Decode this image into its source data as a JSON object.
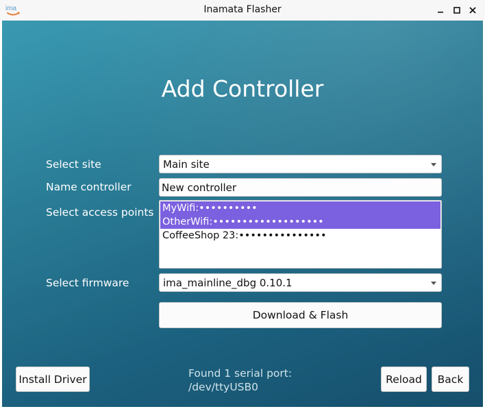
{
  "window": {
    "title": "Inamata Flasher",
    "icon": "ima-logo-icon",
    "icon_text": "ima",
    "controls": {
      "minimize": "minimize-icon",
      "maximize": "maximize-icon",
      "close": "close-icon"
    }
  },
  "page": {
    "heading": "Add Controller"
  },
  "form": {
    "site": {
      "label": "Select site",
      "value": "Main site"
    },
    "name": {
      "label": "Name controller",
      "value": "New controller"
    },
    "access_points": {
      "label": "Select access points",
      "items": [
        {
          "text": "MyWifi:••••••••••",
          "selected": true
        },
        {
          "text": "OtherWifi:•••••••••••••••••••",
          "selected": true
        },
        {
          "text": "CoffeeShop 23:•••••••••••••••",
          "selected": false
        }
      ]
    },
    "firmware": {
      "label": "Select firmware",
      "value": "ima_mainline_dbg 0.10.1"
    },
    "flash_button": "Download & Flash"
  },
  "footer": {
    "install_driver": "Install Driver",
    "status_line1": "Found 1 serial port:",
    "status_line2": "/dev/ttyUSB0",
    "reload": "Reload",
    "back": "Back"
  },
  "colors": {
    "selection": "#7b61df",
    "background_top": "#3a9ab2",
    "background_bottom": "#164f6c",
    "logo_accent": "#e8803a"
  }
}
